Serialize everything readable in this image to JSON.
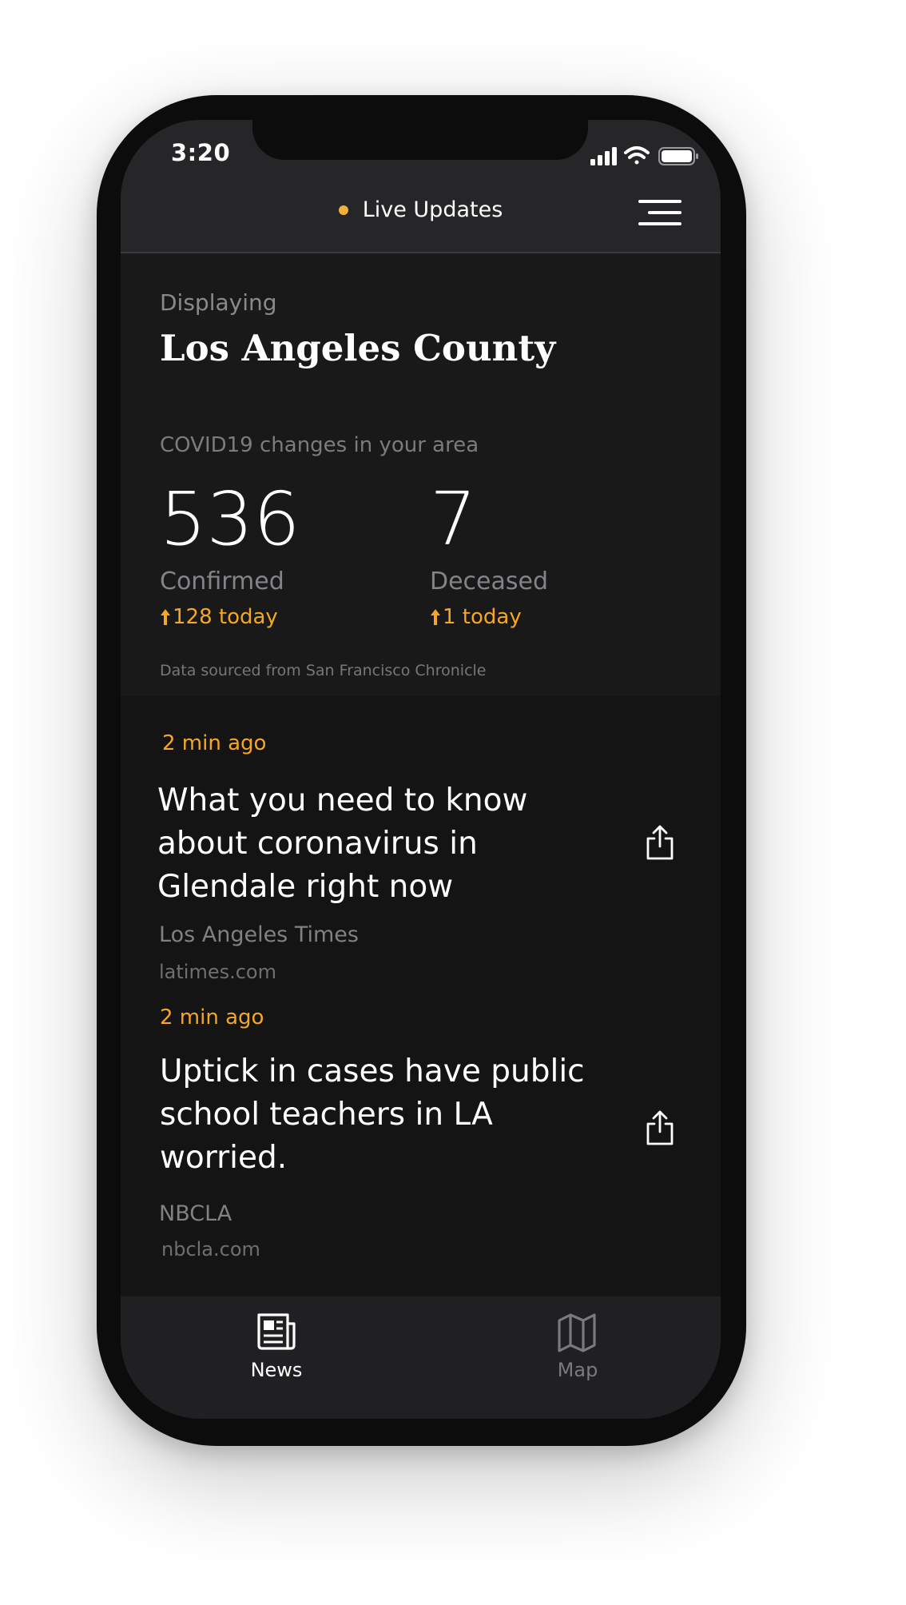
{
  "status_bar": {
    "time": "3:20",
    "icons": [
      "cellular-signal-icon",
      "wifi-icon",
      "battery-icon"
    ]
  },
  "header": {
    "title": "Live Updates",
    "live_indicator_color": "#f3b13a",
    "menu_icon": "hamburger-menu-icon"
  },
  "summary": {
    "displaying_label": "Displaying",
    "region": "Los Angeles County",
    "changes_label": "COVID19 changes in your area",
    "confirmed": {
      "value": "536",
      "label": "Confirmed",
      "delta": "128 today"
    },
    "deceased": {
      "value": "7",
      "label": "Deceased",
      "delta": "1 today"
    },
    "source": "Data sourced from San Francisco Chronicle"
  },
  "articles": [
    {
      "time_ago": "2 min ago",
      "headline": "What you need to know about coronavirus in Glendale right now",
      "publisher": "Los Angeles Times",
      "domain": "latimes.com"
    },
    {
      "time_ago": "2 min ago",
      "headline": "Uptick in cases have public school teachers in LA worried.",
      "publisher": "NBCLA",
      "domain": "nbcla.com"
    }
  ],
  "tabbar": {
    "tabs": [
      {
        "label": "News",
        "icon": "newspaper-icon",
        "active": true
      },
      {
        "label": "Map",
        "icon": "map-icon",
        "active": false
      }
    ]
  },
  "colors": {
    "accent": "#f5a623",
    "background": "#141415",
    "header": "#262628"
  }
}
